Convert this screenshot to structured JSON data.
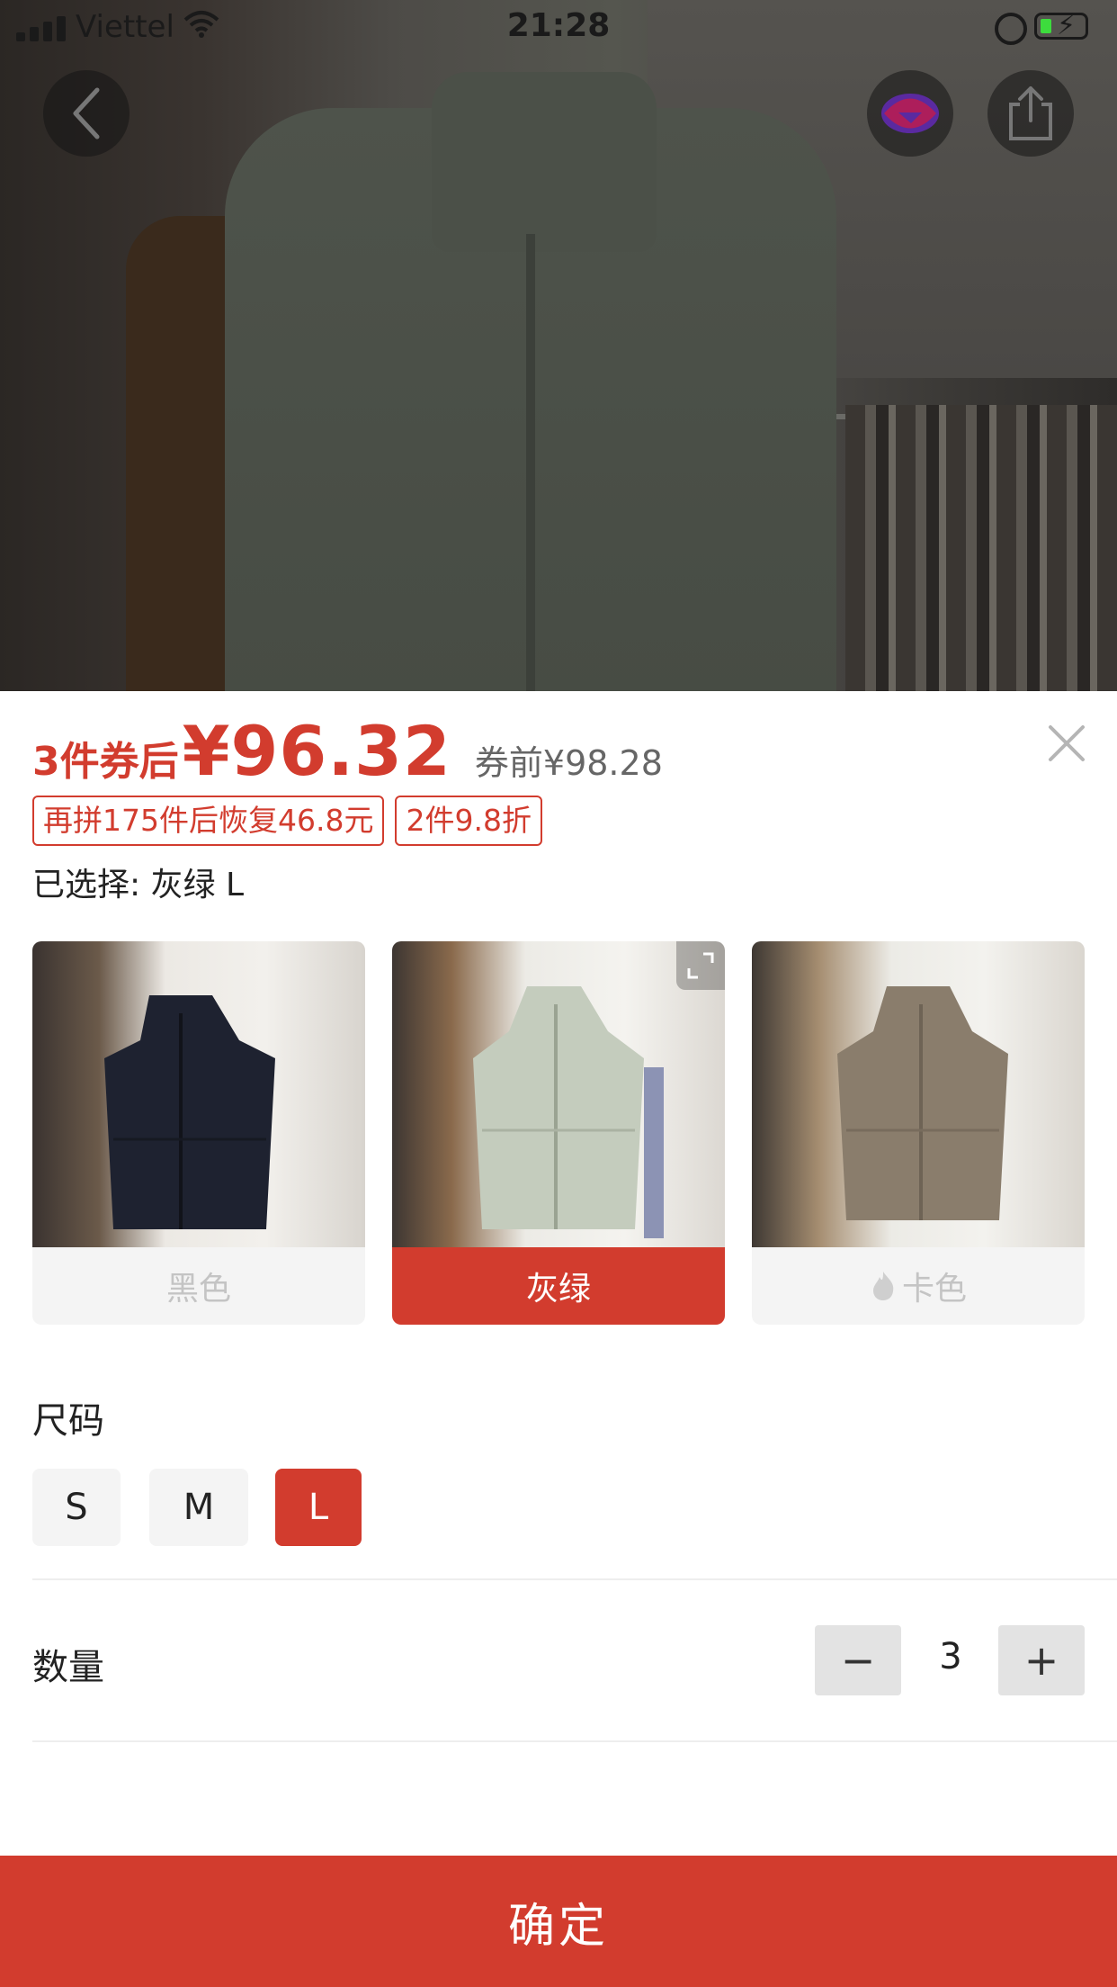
{
  "status_bar": {
    "carrier": "Viettel",
    "time": "21:28"
  },
  "icons": {
    "back": "back-chevron-icon",
    "app": "app-logo-icon",
    "share": "share-icon",
    "close": "close-icon",
    "expand": "expand-icon",
    "hot": "flame-icon"
  },
  "price": {
    "prefix": "3件券后",
    "value": "¥96.32",
    "before_coupon": "券前¥98.28"
  },
  "promotions": [
    "再拼175件后恢复46.8元",
    "2件9.8折"
  ],
  "selected": "已选择: 灰绿 L",
  "colors": {
    "options": [
      {
        "label": "黑色",
        "selected": false
      },
      {
        "label": "灰绿",
        "selected": true
      },
      {
        "label": "卡色",
        "selected": false
      }
    ]
  },
  "size": {
    "title": "尺码",
    "options": [
      {
        "label": "S",
        "selected": false
      },
      {
        "label": "M",
        "selected": false
      },
      {
        "label": "L",
        "selected": true
      }
    ]
  },
  "quantity": {
    "title": "数量",
    "minus": "−",
    "value": "3",
    "plus": "+"
  },
  "confirm_label": "确定",
  "theme": {
    "accent": "#d23c2e",
    "disabled_text": "#c4c4c4",
    "chip_bg": "#f4f4f4"
  }
}
